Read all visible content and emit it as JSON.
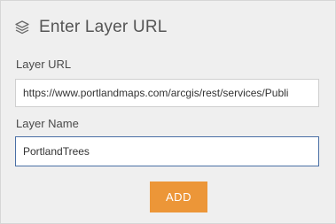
{
  "dialog": {
    "title": "Enter Layer URL",
    "icon": "layers-icon"
  },
  "form": {
    "layer_url": {
      "label": "Layer URL",
      "value": "https://www.portlandmaps.com/arcgis/rest/services/Publi"
    },
    "layer_name": {
      "label": "Layer Name",
      "value": "PortlandTrees"
    },
    "add_button": {
      "label": "ADD",
      "color": "#ec9638"
    }
  }
}
